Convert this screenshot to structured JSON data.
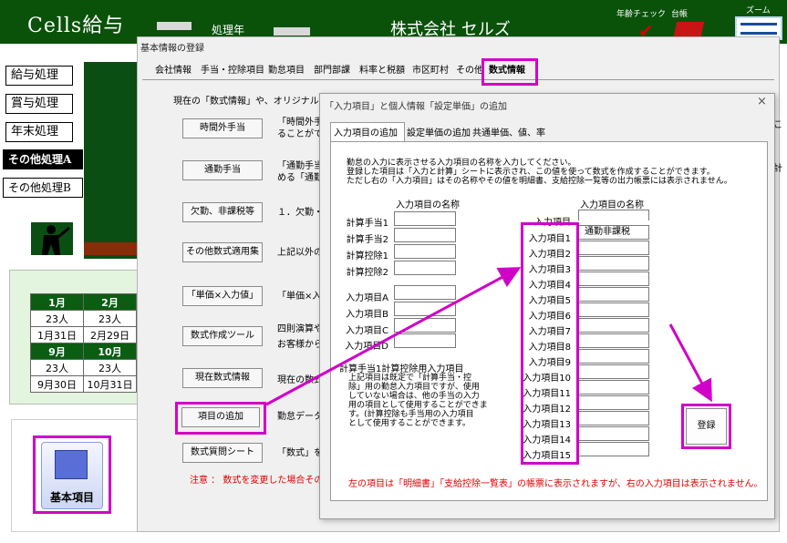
{
  "app": {
    "title": "Cells給与",
    "proc_year_label": "処理年",
    "company": "株式会社 セルズ",
    "toolbar": {
      "age_check": "年齢チェック",
      "ledger": "台帳",
      "zoom": "ズーム"
    }
  },
  "sidebar": {
    "items": [
      {
        "label": "給与処理"
      },
      {
        "label": "賞与処理"
      },
      {
        "label": "年末処理"
      },
      {
        "label": "その他処理A"
      },
      {
        "label": "その他処理B"
      }
    ]
  },
  "calendar": {
    "rows": [
      [
        "1月",
        "2月"
      ],
      [
        "23人",
        "23人"
      ],
      [
        "1月31日",
        "2月29日"
      ],
      [
        "9月",
        "10月"
      ],
      [
        "23人",
        "23人"
      ],
      [
        "9月30日",
        "10月31日"
      ]
    ]
  },
  "home_button": {
    "label": "基本項目",
    "icon": "building-icon"
  },
  "main_dialog": {
    "title": "基本情報の登録",
    "tabs": [
      "会社情報",
      "手当・控除項目",
      "勤怠項目",
      "部門部課",
      "料率と税額",
      "市区町村",
      "その他",
      "数式情報"
    ],
    "active_tab": "数式情報",
    "description": "現在の「数式情報」や、オリジナルの「数式」",
    "buttons": [
      {
        "label": "時間外手当",
        "text": [
          "「時間外手",
          "ることができ"
        ]
      },
      {
        "label": "通勤手当",
        "text": [
          "「通勤手当",
          "める「通勤手"
        ]
      },
      {
        "label": "欠勤、非課税等",
        "text": [
          "１．欠勤・"
        ]
      },
      {
        "label": "その他数式適用集",
        "text": [
          "上記以外の"
        ]
      },
      {
        "label": "「単価×入力値」",
        "text": [
          "「単価×入"
        ]
      },
      {
        "label": "数式作成ツール",
        "text": [
          "四則演算や",
          "お客様から"
        ]
      },
      {
        "label": "現在数式情報",
        "text": [
          "現在の数式"
        ]
      },
      {
        "label": "項目の追加",
        "text": [
          "勤怠データの"
        ]
      },
      {
        "label": "数式質問シート",
        "text": [
          "「数式」を作"
        ]
      }
    ],
    "note": "注意 ： 数式を変更した場合その",
    "right_fragments": [
      "こ",
      "計"
    ]
  },
  "sub_dialog": {
    "title": "「入力項目」と個人情報「設定単価」の追加",
    "close": "×",
    "tabs": [
      "入力項目の追加",
      "設定単価の追加",
      "共通単価、値、率"
    ],
    "active_tab": "入力項目の追加",
    "intro": [
      "勤怠の入力に表示させる入力項目の名称を入力してください。",
      "登録した項目は「入力と計算」シートに表示され、この値を使って数式を作成することができます。",
      "ただし右の「入力項目」はその名称やその値を明細書、支給控除一覧等の出力帳票には表示されません。"
    ],
    "col_header": "入力項目の名称",
    "left_fields": [
      {
        "label": "計算手当1",
        "value": ""
      },
      {
        "label": "計算手当2",
        "value": ""
      },
      {
        "label": "計算控除1",
        "value": ""
      },
      {
        "label": "計算控除2",
        "value": ""
      },
      {
        "label": "入力項目A",
        "value": ""
      },
      {
        "label": "入力項目B",
        "value": ""
      },
      {
        "label": "入力項目C",
        "value": ""
      },
      {
        "label": "入力項目D",
        "value": ""
      }
    ],
    "right_header_label": "入力項目",
    "right_fields": [
      {
        "label": "入力項目1",
        "value": "通勤非課税"
      },
      {
        "label": "入力項目2",
        "value": ""
      },
      {
        "label": "入力項目3",
        "value": ""
      },
      {
        "label": "入力項目4",
        "value": ""
      },
      {
        "label": "入力項目5",
        "value": ""
      },
      {
        "label": "入力項目6",
        "value": ""
      },
      {
        "label": "入力項目7",
        "value": ""
      },
      {
        "label": "入力項目8",
        "value": ""
      },
      {
        "label": "入力項目9",
        "value": ""
      },
      {
        "label": "入力項目10",
        "value": ""
      },
      {
        "label": "入力項目11",
        "value": ""
      },
      {
        "label": "入力項目12",
        "value": ""
      },
      {
        "label": "入力項目13",
        "value": ""
      },
      {
        "label": "入力項目14",
        "value": ""
      },
      {
        "label": "入力項目15",
        "value": ""
      }
    ],
    "calc_heading": "計算手当1計算控除用入力項目",
    "calc_note": [
      "上記項目は既定で「計算手当・控",
      "除」用の勤怠入力項目ですが、使用",
      "していない場合は、他の手当の入力",
      "用の項目として使用することができま",
      "す。(計算控除も手当用の入力項目",
      "として使用することができます。"
    ],
    "register": "登録",
    "bottom_note": "左の項目は「明細書」「支給控除一覧表」の帳票に表示されますが、右の入力項目は表示されません。"
  },
  "colors": {
    "highlight": "#d100c8",
    "top_bar": "#0a520a",
    "note_red": "#e00000"
  }
}
